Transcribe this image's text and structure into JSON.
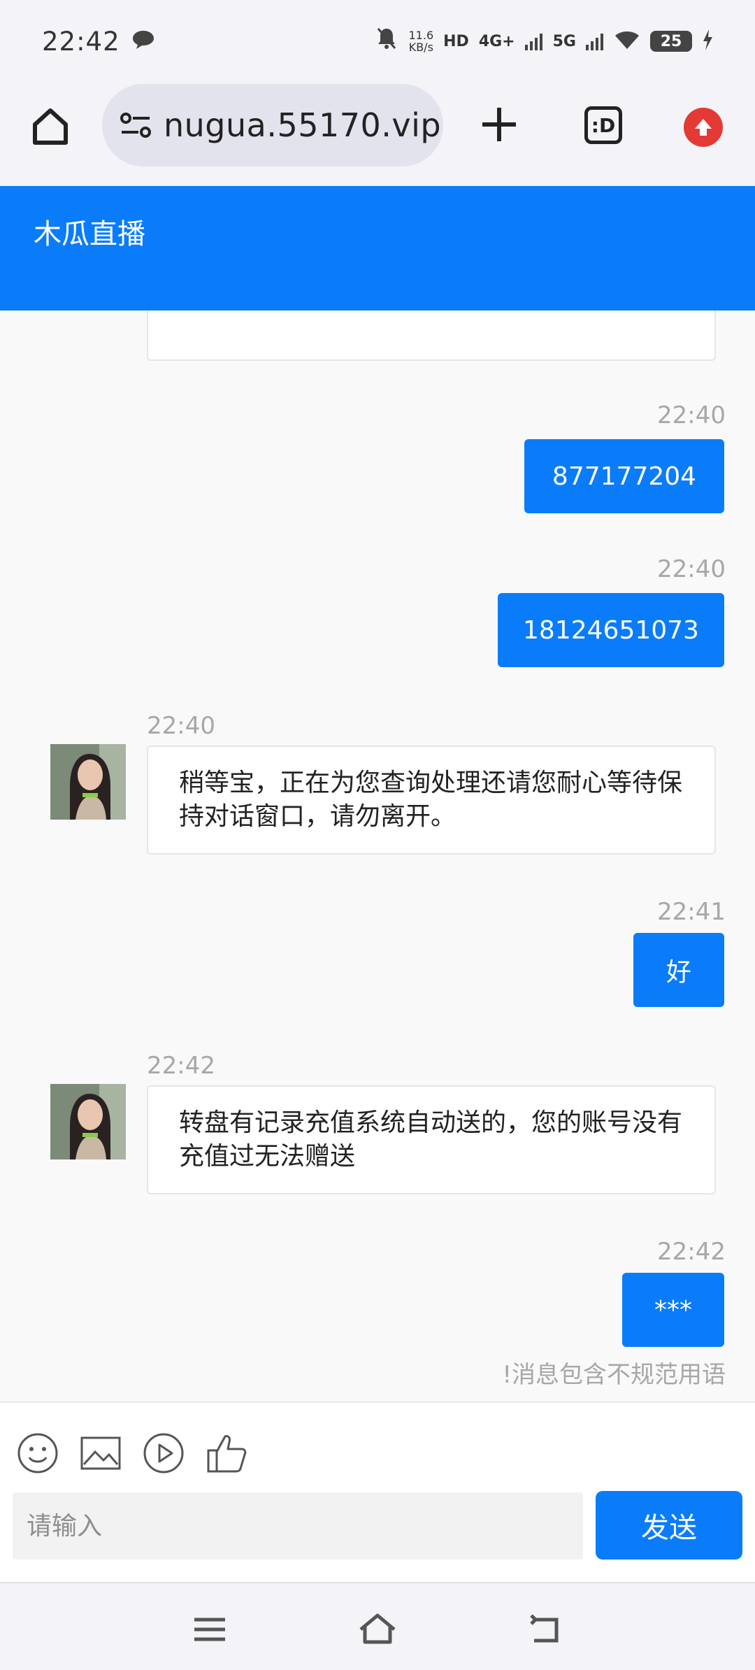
{
  "status_bar": {
    "time": "22:42",
    "net_speed_value": "11.6",
    "net_speed_unit": "KB/s",
    "hd_label": "HD",
    "network_4g": "4G+",
    "network_5g": "5G",
    "battery": "25"
  },
  "browser": {
    "url": "nugua.55170.vip",
    "tabs_label": ":D"
  },
  "app": {
    "title": "木瓜直播"
  },
  "messages": [
    {
      "dir": "out",
      "time": "22:40",
      "text": "877177204"
    },
    {
      "dir": "out",
      "time": "22:40",
      "text": "18124651073"
    },
    {
      "dir": "in",
      "time": "22:40",
      "text": "稍等宝，正在为您查询处理还请您耐心等待保持对话窗口，请勿离开。"
    },
    {
      "dir": "out",
      "time": "22:41",
      "text": "好"
    },
    {
      "dir": "in",
      "time": "22:42",
      "text": "转盘有记录充值系统自动送的，您的账号没有充值过无法赠送"
    },
    {
      "dir": "out",
      "time": "22:42",
      "text": "***",
      "warning": "!消息包含不规范用语"
    }
  ],
  "composer": {
    "placeholder": "请输入",
    "send_label": "发送",
    "tools": [
      "emoji-icon",
      "image-icon",
      "video-icon",
      "thumbs-up-icon"
    ]
  },
  "colors": {
    "accent": "#0a7cfa",
    "upload_red": "#e53935"
  }
}
